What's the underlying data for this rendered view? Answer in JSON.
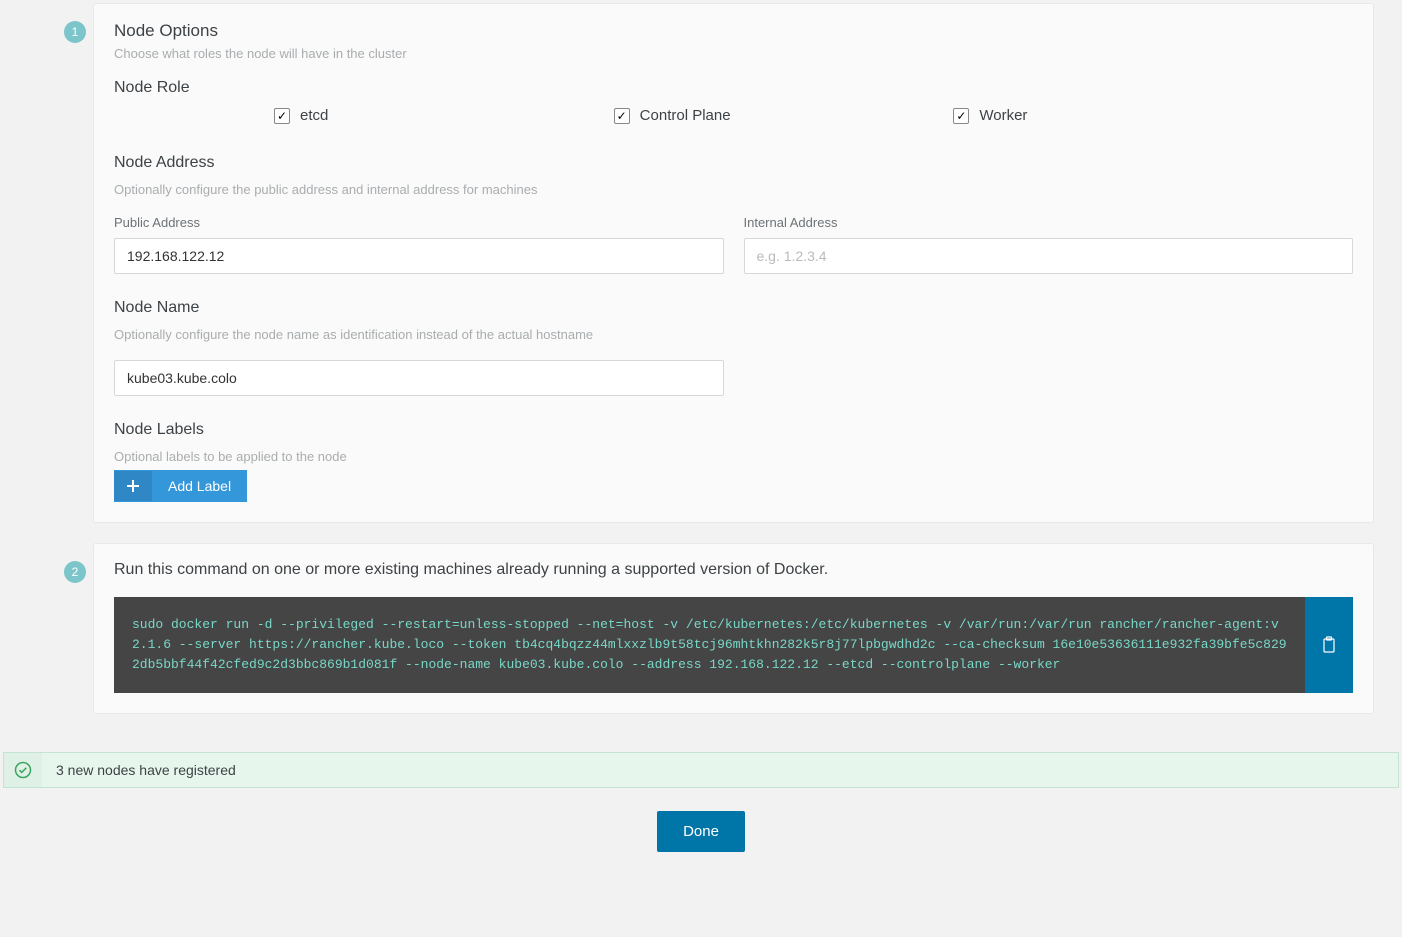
{
  "step1": {
    "badge": "1",
    "title": "Node Options",
    "desc": "Choose what roles the node will have in the cluster",
    "role": {
      "title": "Node Role",
      "options": {
        "etcd": {
          "label": "etcd",
          "checked": true
        },
        "control": {
          "label": "Control Plane",
          "checked": true
        },
        "worker": {
          "label": "Worker",
          "checked": true
        }
      }
    },
    "address": {
      "title": "Node Address",
      "desc": "Optionally configure the public address and internal address for machines",
      "public_label": "Public Address",
      "public_value": "192.168.122.12",
      "internal_label": "Internal Address",
      "internal_placeholder": "e.g. 1.2.3.4"
    },
    "name": {
      "title": "Node Name",
      "desc": "Optionally configure the node name as identification instead of the actual hostname",
      "value": "kube03.kube.colo"
    },
    "labels": {
      "title": "Node Labels",
      "desc": "Optional labels to be applied to the node",
      "button": "Add Label"
    }
  },
  "step2": {
    "badge": "2",
    "text": "Run this command on one or more existing machines already running a supported version of Docker.",
    "command": "sudo docker run -d --privileged --restart=unless-stopped --net=host -v /etc/kubernetes:/etc/kubernetes -v /var/run:/var/run rancher/rancher-agent:v2.1.6 --server https://rancher.kube.loco --token tb4cq4bqzz44mlxxzlb9t58tcj96mhtkhn282k5r8j77lpbgwdhd2c --ca-checksum 16e10e53636111e932fa39bfe5c8292db5bbf44f42cfed9c2d3bbc869b1d081f --node-name kube03.kube.colo --address 192.168.122.12 --etcd --controlplane --worker"
  },
  "notification": "3 new nodes have registered",
  "done_button": "Done"
}
